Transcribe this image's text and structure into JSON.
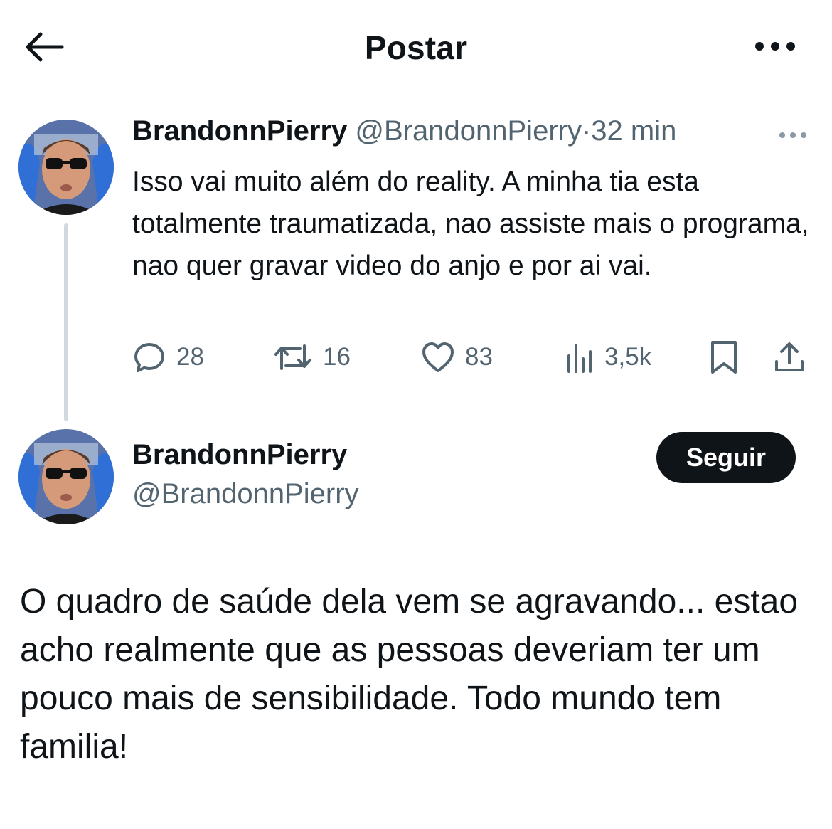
{
  "header": {
    "title": "Postar",
    "back_icon": "arrow-left-icon",
    "more_icon": "more-horizontal-icon"
  },
  "parent_tweet": {
    "display_name": "BrandonnPierry",
    "handle": "@BrandonnPierry",
    "separator": "·",
    "time": "32 min",
    "text": "Isso vai muito além do reality. A minha tia esta totalmente traumatizada, nao assiste mais o programa, nao quer gravar video do anjo e por ai vai.",
    "actions": {
      "replies": "28",
      "retweets": "16",
      "likes": "83",
      "views": "3,5k"
    }
  },
  "main_tweet": {
    "display_name": "BrandonnPierry",
    "handle": "@BrandonnPierry",
    "follow_label": "Seguir",
    "text": "O quadro de saúde dela vem se agravando... estao acho realmente que as pessoas deveriam ter um pouco mais de sensibilidade. Todo mundo tem familia!"
  },
  "colors": {
    "text": "#0f1419",
    "secondary": "#536471",
    "thread_line": "#cfd9de",
    "follow_bg": "#0f1419"
  }
}
